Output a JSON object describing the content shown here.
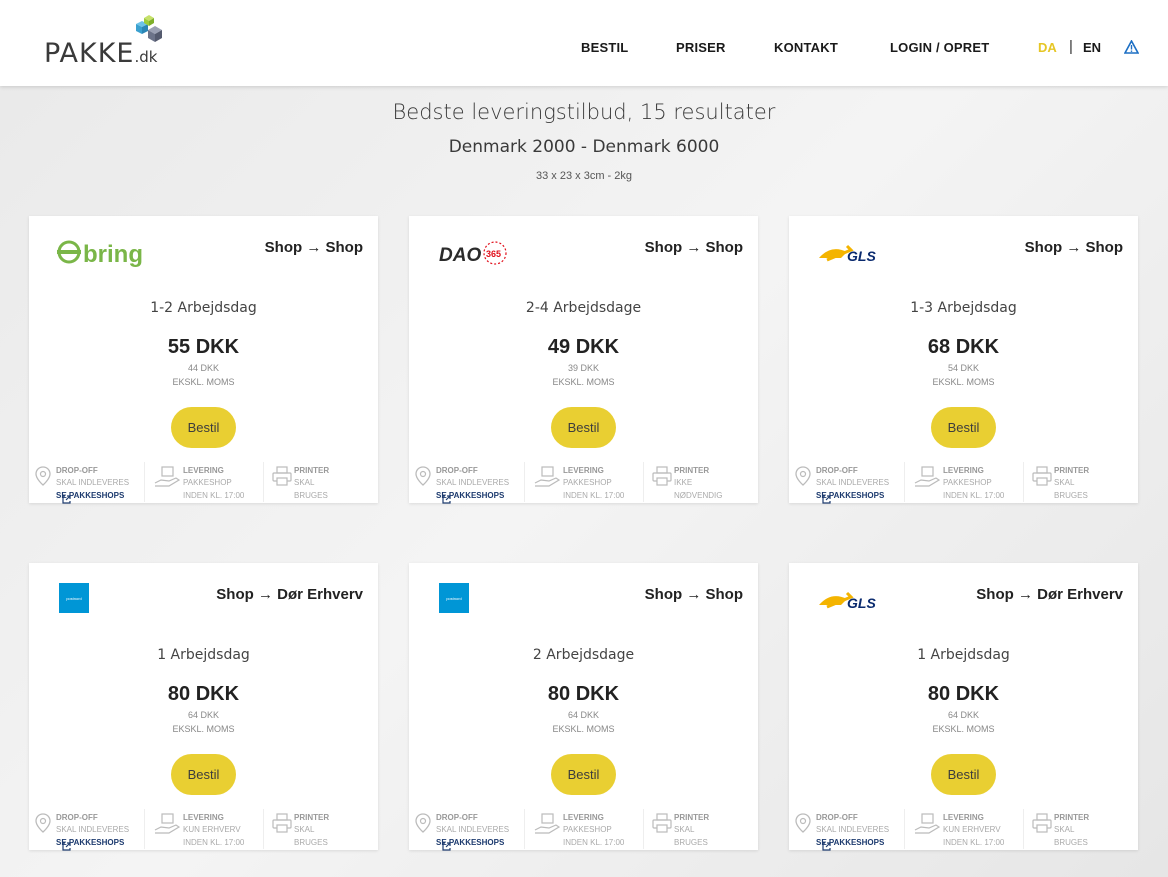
{
  "brand": {
    "name": "PAKKE",
    "suffix": ".dk"
  },
  "nav": {
    "items": [
      "BESTIL",
      "PRISER",
      "KONTAKT",
      "LOGIN / OPRET"
    ],
    "lang_da": "DA",
    "lang_sep": "|",
    "lang_en": "EN"
  },
  "summary": {
    "headline": "Bedste leveringstilbud, 15 resultater",
    "route": "Denmark 2000 - Denmark 6000",
    "dims": "33 x 23 x 3cm - 2kg"
  },
  "colors": {
    "accent": "#e9cf32",
    "link": "#1c3a6e",
    "postnord": "#0096d6",
    "bring": "#7ab648",
    "gls": "#f4b400",
    "dao_red": "#e10e1a"
  },
  "labels": {
    "button": "Bestil",
    "excl": "EKSKL. MOMS",
    "dropoff": "DROP-OFF",
    "delivery": "LEVERING",
    "printer": "PRINTER",
    "see_shops": "SE PAKKESHOPS"
  },
  "offers": [
    {
      "carrier": "bring",
      "logo_text": "bring",
      "service": "Shop → Shop",
      "days": "1-2 Arbejdsdag",
      "price": "55 DKK",
      "net": "44 DKK",
      "dropoff": [
        "SKAL INDLEVERES"
      ],
      "delivery": [
        "PAKKESHOP",
        "INDEN KL. 17:00"
      ],
      "printer": [
        "SKAL",
        "BRUGES"
      ]
    },
    {
      "carrier": "dao",
      "logo_text": "DAO",
      "logo_badge": "365",
      "service": "Shop → Shop",
      "days": "2-4 Arbejdsdage",
      "price": "49 DKK",
      "net": "39 DKK",
      "dropoff": [
        "SKAL INDLEVERES"
      ],
      "delivery": [
        "PAKKESHOP",
        "INDEN KL. 17:00"
      ],
      "printer": [
        "IKKE",
        "NØDVENDIG"
      ]
    },
    {
      "carrier": "gls",
      "logo_text": "GLS",
      "service": "Shop → Shop",
      "days": "1-3 Arbejdsdag",
      "price": "68 DKK",
      "net": "54 DKK",
      "dropoff": [
        "SKAL INDLEVERES"
      ],
      "delivery": [
        "PAKKESHOP",
        "INDEN KL. 17:00"
      ],
      "printer": [
        "SKAL",
        "BRUGES"
      ]
    },
    {
      "carrier": "postnord",
      "logo_text": "postnord",
      "service": "Shop → Dør Erhverv",
      "days": "1 Arbejdsdag",
      "price": "80 DKK",
      "net": "64 DKK",
      "dropoff": [
        "SKAL INDLEVERES"
      ],
      "delivery": [
        "KUN ERHVERV",
        "INDEN KL. 17:00"
      ],
      "printer": [
        "SKAL",
        "BRUGES"
      ]
    },
    {
      "carrier": "postnord",
      "logo_text": "postnord",
      "service": "Shop → Shop",
      "days": "2 Arbejdsdage",
      "price": "80 DKK",
      "net": "64 DKK",
      "dropoff": [
        "SKAL INDLEVERES"
      ],
      "delivery": [
        "PAKKESHOP",
        "INDEN KL. 17:00"
      ],
      "printer": [
        "SKAL",
        "BRUGES"
      ]
    },
    {
      "carrier": "gls",
      "logo_text": "GLS",
      "service": "Shop → Dør Erhverv",
      "days": "1 Arbejdsdag",
      "price": "80 DKK",
      "net": "64 DKK",
      "dropoff": [
        "SKAL INDLEVERES"
      ],
      "delivery": [
        "KUN ERHVERV",
        "INDEN KL. 17:00"
      ],
      "printer": [
        "SKAL",
        "BRUGES"
      ]
    }
  ]
}
